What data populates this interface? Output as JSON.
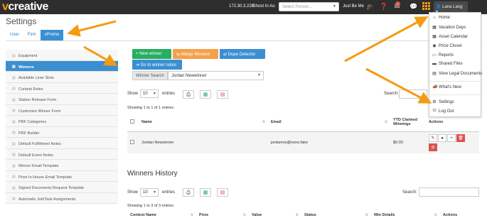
{
  "topbar": {
    "logo_v": "v",
    "logo_rest": "creative",
    "ip": "172.30.3.220",
    "ghost_label": "Ghost In As:",
    "ghost_placeholder": "Select Person...",
    "just_me": "Just Be Me",
    "notification_count": "2",
    "user_name": "Lana Lang"
  },
  "page_title": "Settings",
  "tabs": [
    {
      "label": "User",
      "active": false
    },
    {
      "label": "Firm",
      "active": false
    },
    {
      "label": "vPromo",
      "active": true
    }
  ],
  "sidebar": {
    "items": [
      {
        "label": "Equipment",
        "icon": "sliders-icon",
        "active": false
      },
      {
        "label": "Winners",
        "icon": "sliders-icon",
        "active": true
      },
      {
        "label": "Available Liner Slots",
        "icon": "sliders-icon",
        "active": false
      },
      {
        "label": "Contest Roles",
        "icon": "sliders-icon",
        "active": false
      },
      {
        "label": "Station Release Form",
        "icon": "sliders-icon",
        "active": false
      },
      {
        "label": "Customize Winner Form",
        "icon": "sliders-icon",
        "active": false
      },
      {
        "label": "PRF Categories",
        "icon": "sliders-icon",
        "active": false
      },
      {
        "label": "PRF Builder",
        "icon": "sliders-icon",
        "active": false
      },
      {
        "label": "Default Fulfillment Notes",
        "icon": "sliders-icon",
        "active": false
      },
      {
        "label": "Default Event Notes",
        "icon": "sliders-icon",
        "active": false
      },
      {
        "label": "Winner Email Template",
        "icon": "sliders-icon",
        "active": false
      },
      {
        "label": "Prize In House Email Template",
        "icon": "sliders-icon",
        "active": false
      },
      {
        "label": "Signed Documents Request Template",
        "icon": "sliders-icon",
        "active": false
      },
      {
        "label": "Automatic Job/Task Assignments",
        "icon": "sliders-icon",
        "active": false
      }
    ]
  },
  "actions": {
    "new_winner": "New winner",
    "merge_winners": "Merge Winners",
    "dupe_detector": "Dupe Detector",
    "go_to_notes": "Go to winner notes"
  },
  "winner_search": {
    "label": "Winner Search",
    "value": "Jordan Newwinner"
  },
  "winners_table": {
    "show_label": "Show",
    "entries_value": "10",
    "entries_label": "entries",
    "search_label": "Search:",
    "info": "Showing 1 to 1 of 1 entries",
    "columns": [
      "Name",
      "Email",
      "YTD Claimed Winnings",
      "Actions"
    ],
    "rows": [
      {
        "name": "Jordan Newwinner",
        "email": "jordannw@none.fake",
        "ytd": "$0.00"
      }
    ]
  },
  "history": {
    "title": "Winners History",
    "show_label": "Show",
    "entries_value": "10",
    "entries_label": "entries",
    "search_label": "Search:",
    "info": "Showing 1 to 3 of 3 entries",
    "columns": [
      "Contest Name",
      "Prize",
      "Value",
      "Status",
      "Win Details",
      "Actions"
    ]
  },
  "user_menu": {
    "items": [
      {
        "label": "Home",
        "icon": "home-icon"
      },
      {
        "label": "Vacation Days",
        "icon": "calendar-icon"
      },
      {
        "label": "Asset Calendar",
        "icon": "calendar-icon"
      },
      {
        "label": "Prize Closet",
        "icon": "gift-icon"
      },
      {
        "label": "Reports",
        "icon": "report-icon"
      },
      {
        "label": "Shared Files",
        "icon": "folder-icon"
      },
      {
        "label": "View Legal Documents",
        "icon": "document-icon"
      },
      {
        "label": "What's New",
        "icon": "megaphone-icon"
      },
      {
        "label": "Settings",
        "icon": "gear-icon"
      },
      {
        "label": "Log Out",
        "icon": "power-icon"
      }
    ]
  },
  "colors": {
    "accent_blue": "#3b8fd1",
    "green": "#27ae60",
    "orange": "#f5a04a",
    "danger": "#d9534f",
    "topbar": "#2e2e2e",
    "annotation_arrow": "#f39c12"
  }
}
